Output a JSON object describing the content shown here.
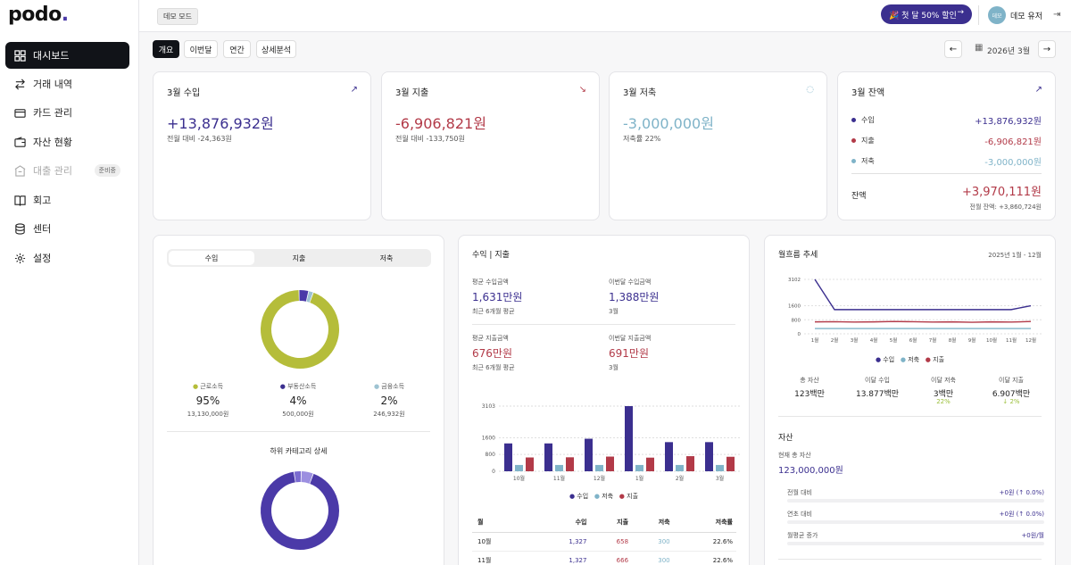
{
  "app": {
    "logo_text": "podo",
    "logo_dot": "."
  },
  "sidebar": {
    "items": [
      {
        "label": "대시보드",
        "icon": "grid-icon",
        "active": true
      },
      {
        "label": "거래 내역",
        "icon": "swap-icon"
      },
      {
        "label": "카드 관리",
        "icon": "card-icon"
      },
      {
        "label": "자산 현황",
        "icon": "wallet-icon"
      },
      {
        "label": "대출 관리",
        "icon": "loan-icon",
        "disabled": true,
        "badge": "준비중"
      },
      {
        "label": "회고",
        "icon": "book-icon"
      },
      {
        "label": "센터",
        "icon": "database-icon"
      },
      {
        "label": "설정",
        "icon": "gear-icon"
      }
    ]
  },
  "topbar": {
    "demo_badge": "데모 모드",
    "promo_label": "🎉 첫 달 50% 할인",
    "avatar_text": "데모",
    "user_name": "데모 유저"
  },
  "tabs": [
    "개요",
    "이번달",
    "연간",
    "상세분석"
  ],
  "period": {
    "label": "2026년 3월"
  },
  "colors": {
    "income": "#3b2f8f",
    "expense": "#b23a48",
    "saving": "#7fb3c8",
    "labor": "#b5bd3a",
    "property": "#4b3aa8",
    "finance": "#9ec3d2"
  },
  "cards": {
    "income": {
      "title": "3월 수입",
      "value": "+13,876,932원",
      "sub": "전월 대비 -24,363원"
    },
    "expense": {
      "title": "3월 지출",
      "value": "-6,906,821원",
      "sub": "전월 대비 -133,750원"
    },
    "saving": {
      "title": "3월 저축",
      "value": "-3,000,000원",
      "sub": "저축률 22%"
    },
    "balance": {
      "title": "3월 잔액",
      "rows": [
        {
          "label": "수입",
          "value": "+13,876,932원"
        },
        {
          "label": "지출",
          "value": "-6,906,821원"
        },
        {
          "label": "저축",
          "value": "-3,000,000원"
        }
      ],
      "total_label": "잔액",
      "total_value": "+3,970,111원",
      "prev": "전월 잔액: +3,860,724원"
    }
  },
  "breakdown": {
    "segments": [
      "수입",
      "지출",
      "저축"
    ],
    "legend": [
      {
        "name": "근로소득",
        "pct": "95%",
        "amount": "13,130,000원"
      },
      {
        "name": "부동산소득",
        "pct": "4%",
        "amount": "500,000원"
      },
      {
        "name": "금융소득",
        "pct": "2%",
        "amount": "246,932원"
      }
    ],
    "donut_values": [
      95,
      4,
      2
    ],
    "sub_title": "하위 카테고리 상세",
    "sub_donut_values": [
      92,
      3,
      5
    ]
  },
  "income_expense": {
    "title": "수익 | 지출",
    "stats": [
      {
        "label": "평균 수입금액",
        "value": "1,631만원",
        "note": "최근 6개월 평균"
      },
      {
        "label": "이번달 수입금액",
        "value": "1,388만원",
        "note": "3월"
      },
      {
        "label": "평균 지출금액",
        "value": "676만원",
        "note": "최근 6개월 평균"
      },
      {
        "label": "이번달 지출금액",
        "value": "691만원",
        "note": "3월"
      }
    ],
    "legend": [
      "수입",
      "저축",
      "지출"
    ],
    "table": {
      "headers": [
        "월",
        "수입",
        "지출",
        "저축",
        "저축률"
      ],
      "rows": [
        [
          "10월",
          "1,327",
          "658",
          "300",
          "22.6%"
        ],
        [
          "11월",
          "1,327",
          "666",
          "300",
          "22.6%"
        ]
      ]
    }
  },
  "chart_data": [
    {
      "type": "bar",
      "categories": [
        "10월",
        "11월",
        "12월",
        "1월",
        "2월",
        "3월"
      ],
      "series": [
        {
          "name": "수입",
          "values": [
            1327,
            1327,
            1550,
            3103,
            1388,
            1388
          ]
        },
        {
          "name": "저축",
          "values": [
            300,
            300,
            300,
            300,
            300,
            300
          ]
        },
        {
          "name": "지출",
          "values": [
            658,
            666,
            700,
            650,
            720,
            691
          ]
        }
      ],
      "yticks": [
        0,
        800,
        1600,
        3103
      ],
      "ylim": [
        0,
        3103
      ]
    },
    {
      "type": "line",
      "categories": [
        "1월",
        "2월",
        "3월",
        "4월",
        "5월",
        "6월",
        "7월",
        "8월",
        "9월",
        "10월",
        "11월",
        "12월"
      ],
      "series": [
        {
          "name": "수입",
          "values": [
            3103,
            1380,
            1380,
            1380,
            1380,
            1380,
            1380,
            1380,
            1380,
            1380,
            1380,
            1600
          ]
        },
        {
          "name": "저축",
          "values": [
            300,
            300,
            300,
            300,
            300,
            300,
            300,
            300,
            300,
            300,
            300,
            300
          ]
        },
        {
          "name": "지출",
          "values": [
            680,
            690,
            670,
            680,
            700,
            690,
            670,
            680,
            660,
            680,
            670,
            700
          ]
        }
      ],
      "yticks": [
        0,
        800,
        1600,
        3102
      ],
      "ylim": [
        0,
        3102
      ]
    }
  ],
  "trend": {
    "title": "월흐름 추세",
    "range": "2025년 1월 - 12월",
    "legend": [
      "수입",
      "저축",
      "지출"
    ],
    "summary": [
      {
        "label": "총 자산",
        "value": "123백만",
        "delta": ""
      },
      {
        "label": "이달 수입",
        "value": "13.877백만",
        "delta": ""
      },
      {
        "label": "이달 저축",
        "value": "3백만",
        "delta": "22%"
      },
      {
        "label": "이달 지출",
        "value": "6.907백만",
        "delta": "↓ 2%"
      }
    ],
    "asset_title": "자산",
    "asset_label": "현재 총 자산",
    "asset_value": "123,000,000원",
    "asset_rows": [
      {
        "label": "전월 대비",
        "value": "+0원 (↑ 0.0%)"
      },
      {
        "label": "연초 대비",
        "value": "+0원 (↑ 0.0%)"
      },
      {
        "label": "월평균 증가",
        "value": "+0원/월"
      }
    ]
  }
}
